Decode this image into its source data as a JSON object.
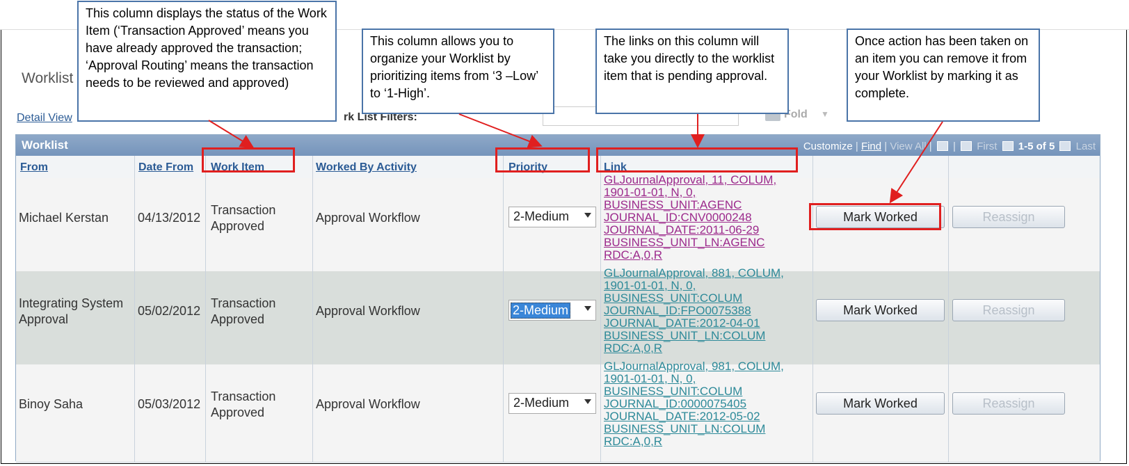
{
  "page": {
    "title": "Worklist",
    "detail_view": "Detail View",
    "filters_label": "rk List Filters:",
    "fold_label": "Fold"
  },
  "grid": {
    "title": "Worklist",
    "nav": {
      "customize": "Customize",
      "find": "Find",
      "view_all": "View All",
      "first": "First",
      "count": "1-5 of 5",
      "last": "Last"
    },
    "columns": {
      "from": "From",
      "date_from": "Date From",
      "work_item": "Work Item",
      "worked_by_activity": "Worked By Activity",
      "priority": "Priority",
      "link": "Link"
    },
    "rows": [
      {
        "from": "Michael Kerstan",
        "date": "04/13/2012",
        "work_item": "Transaction\nApproved",
        "activity": "Approval Workflow",
        "priority": "2-Medium",
        "link": "GLJournalApproval, 11, COLUM,\n1901-01-01, N, 0,\nBUSINESS_UNIT:AGENC\nJOURNAL_ID:CNV0000248\nJOURNAL_DATE:2011-06-29\nBUSINESS_UNIT_LN:AGENC\nRDC:A,0,R",
        "mark_label": "Mark Worked",
        "reassign_label": "Reassign"
      },
      {
        "from": "Integrating System\nApproval",
        "date": "05/02/2012",
        "work_item": "Transaction\nApproved",
        "activity": "Approval Workflow",
        "priority": "2-Medium",
        "link": "GLJournalApproval, 881, COLUM,\n1901-01-01, N, 0,\nBUSINESS_UNIT:COLUM\nJOURNAL_ID:FPO0075388\nJOURNAL_DATE:2012-04-01\nBUSINESS_UNIT_LN:COLUM\nRDC:A,0,R",
        "mark_label": "Mark Worked",
        "reassign_label": "Reassign"
      },
      {
        "from": "Binoy Saha",
        "date": "05/03/2012",
        "work_item": "Transaction\nApproved",
        "activity": "Approval Workflow",
        "priority": "2-Medium",
        "link": "GLJournalApproval, 981, COLUM,\n1901-01-01, N, 0,\nBUSINESS_UNIT:COLUM\nJOURNAL_ID:0000075405\nJOURNAL_DATE:2012-05-02\nBUSINESS_UNIT_LN:COLUM\nRDC:A,0,R",
        "mark_label": "Mark Worked",
        "reassign_label": "Reassign"
      }
    ]
  },
  "callouts": {
    "work_item": "This column  displays the status of the Work Item (‘Transaction Approved’ means you have already approved the transaction; ‘Approval Routing’ means the transaction needs to be reviewed and approved)",
    "priority": "This column allows you to organize your Worklist by prioritizing items from  ‘3 –Low’ to ‘1-High’.",
    "link": "The links on this column will take you directly to the worklist  item that is pending approval.",
    "mark_worked": "Once action has been taken on an item you can remove it from your Worklist by marking it as complete."
  },
  "colors": {
    "link_visited": "#9c2a8c",
    "link_default": "#2e8a99",
    "highlight_red": "#e01f1f",
    "callout_border": "#4a74a8",
    "grid_header": "#7c99bf"
  },
  "icons": [
    "fold-icon",
    "zoom-icon",
    "download-icon",
    "first-arrow-icon",
    "last-arrow-icon",
    "dropdown-arrow-icon"
  ]
}
